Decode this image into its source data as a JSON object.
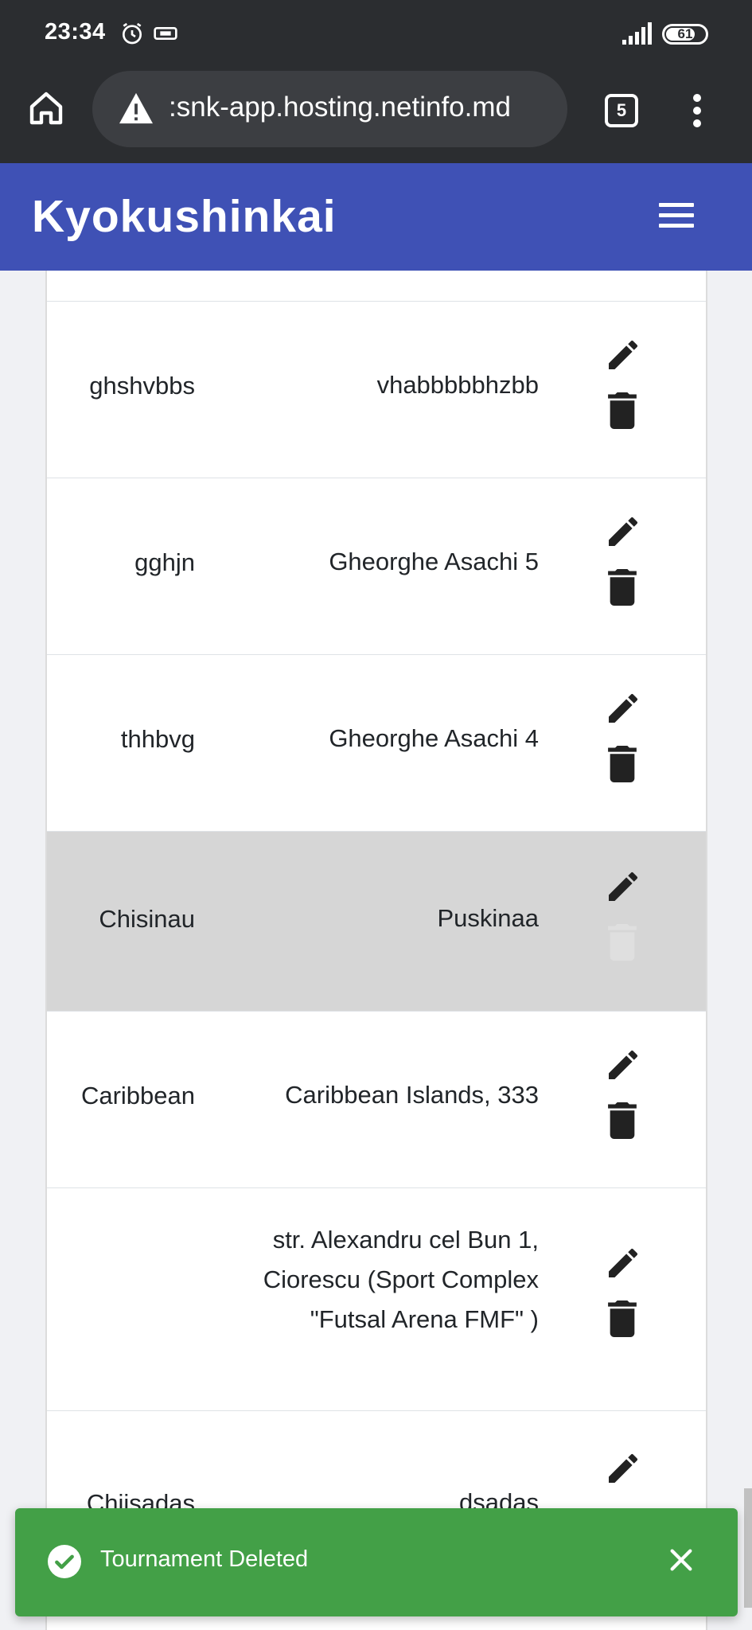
{
  "status_bar": {
    "time": "23:34",
    "battery": "61"
  },
  "browser": {
    "url": ":snk-app.hosting.netinfo.md",
    "tab_count": "5"
  },
  "app": {
    "title": "Kyokushinkai"
  },
  "table": {
    "rows": [
      {
        "city": "ghshvbbs",
        "address": "vhabbbbbhzbb"
      },
      {
        "city": "gghjn",
        "address": "Gheorghe Asachi 5"
      },
      {
        "city": "thhbvg",
        "address": "Gheorghe Asachi 4"
      },
      {
        "city": "Chisinau",
        "address": "Puskinaa"
      },
      {
        "city": "Caribbean",
        "address": "Caribbean Islands, 333"
      },
      {
        "city": "",
        "address": "str. Alexandru cel Bun 1, Ciorescu (Sport Complex \"Futsal Arena FMF\" )"
      },
      {
        "city": "Chiisadas",
        "address": "dsadas"
      }
    ]
  },
  "toast": {
    "message": "Tournament Deleted"
  },
  "colors": {
    "header": "#3f51b5",
    "toast": "#43a047",
    "highlight_row": "#d6d6d6"
  }
}
